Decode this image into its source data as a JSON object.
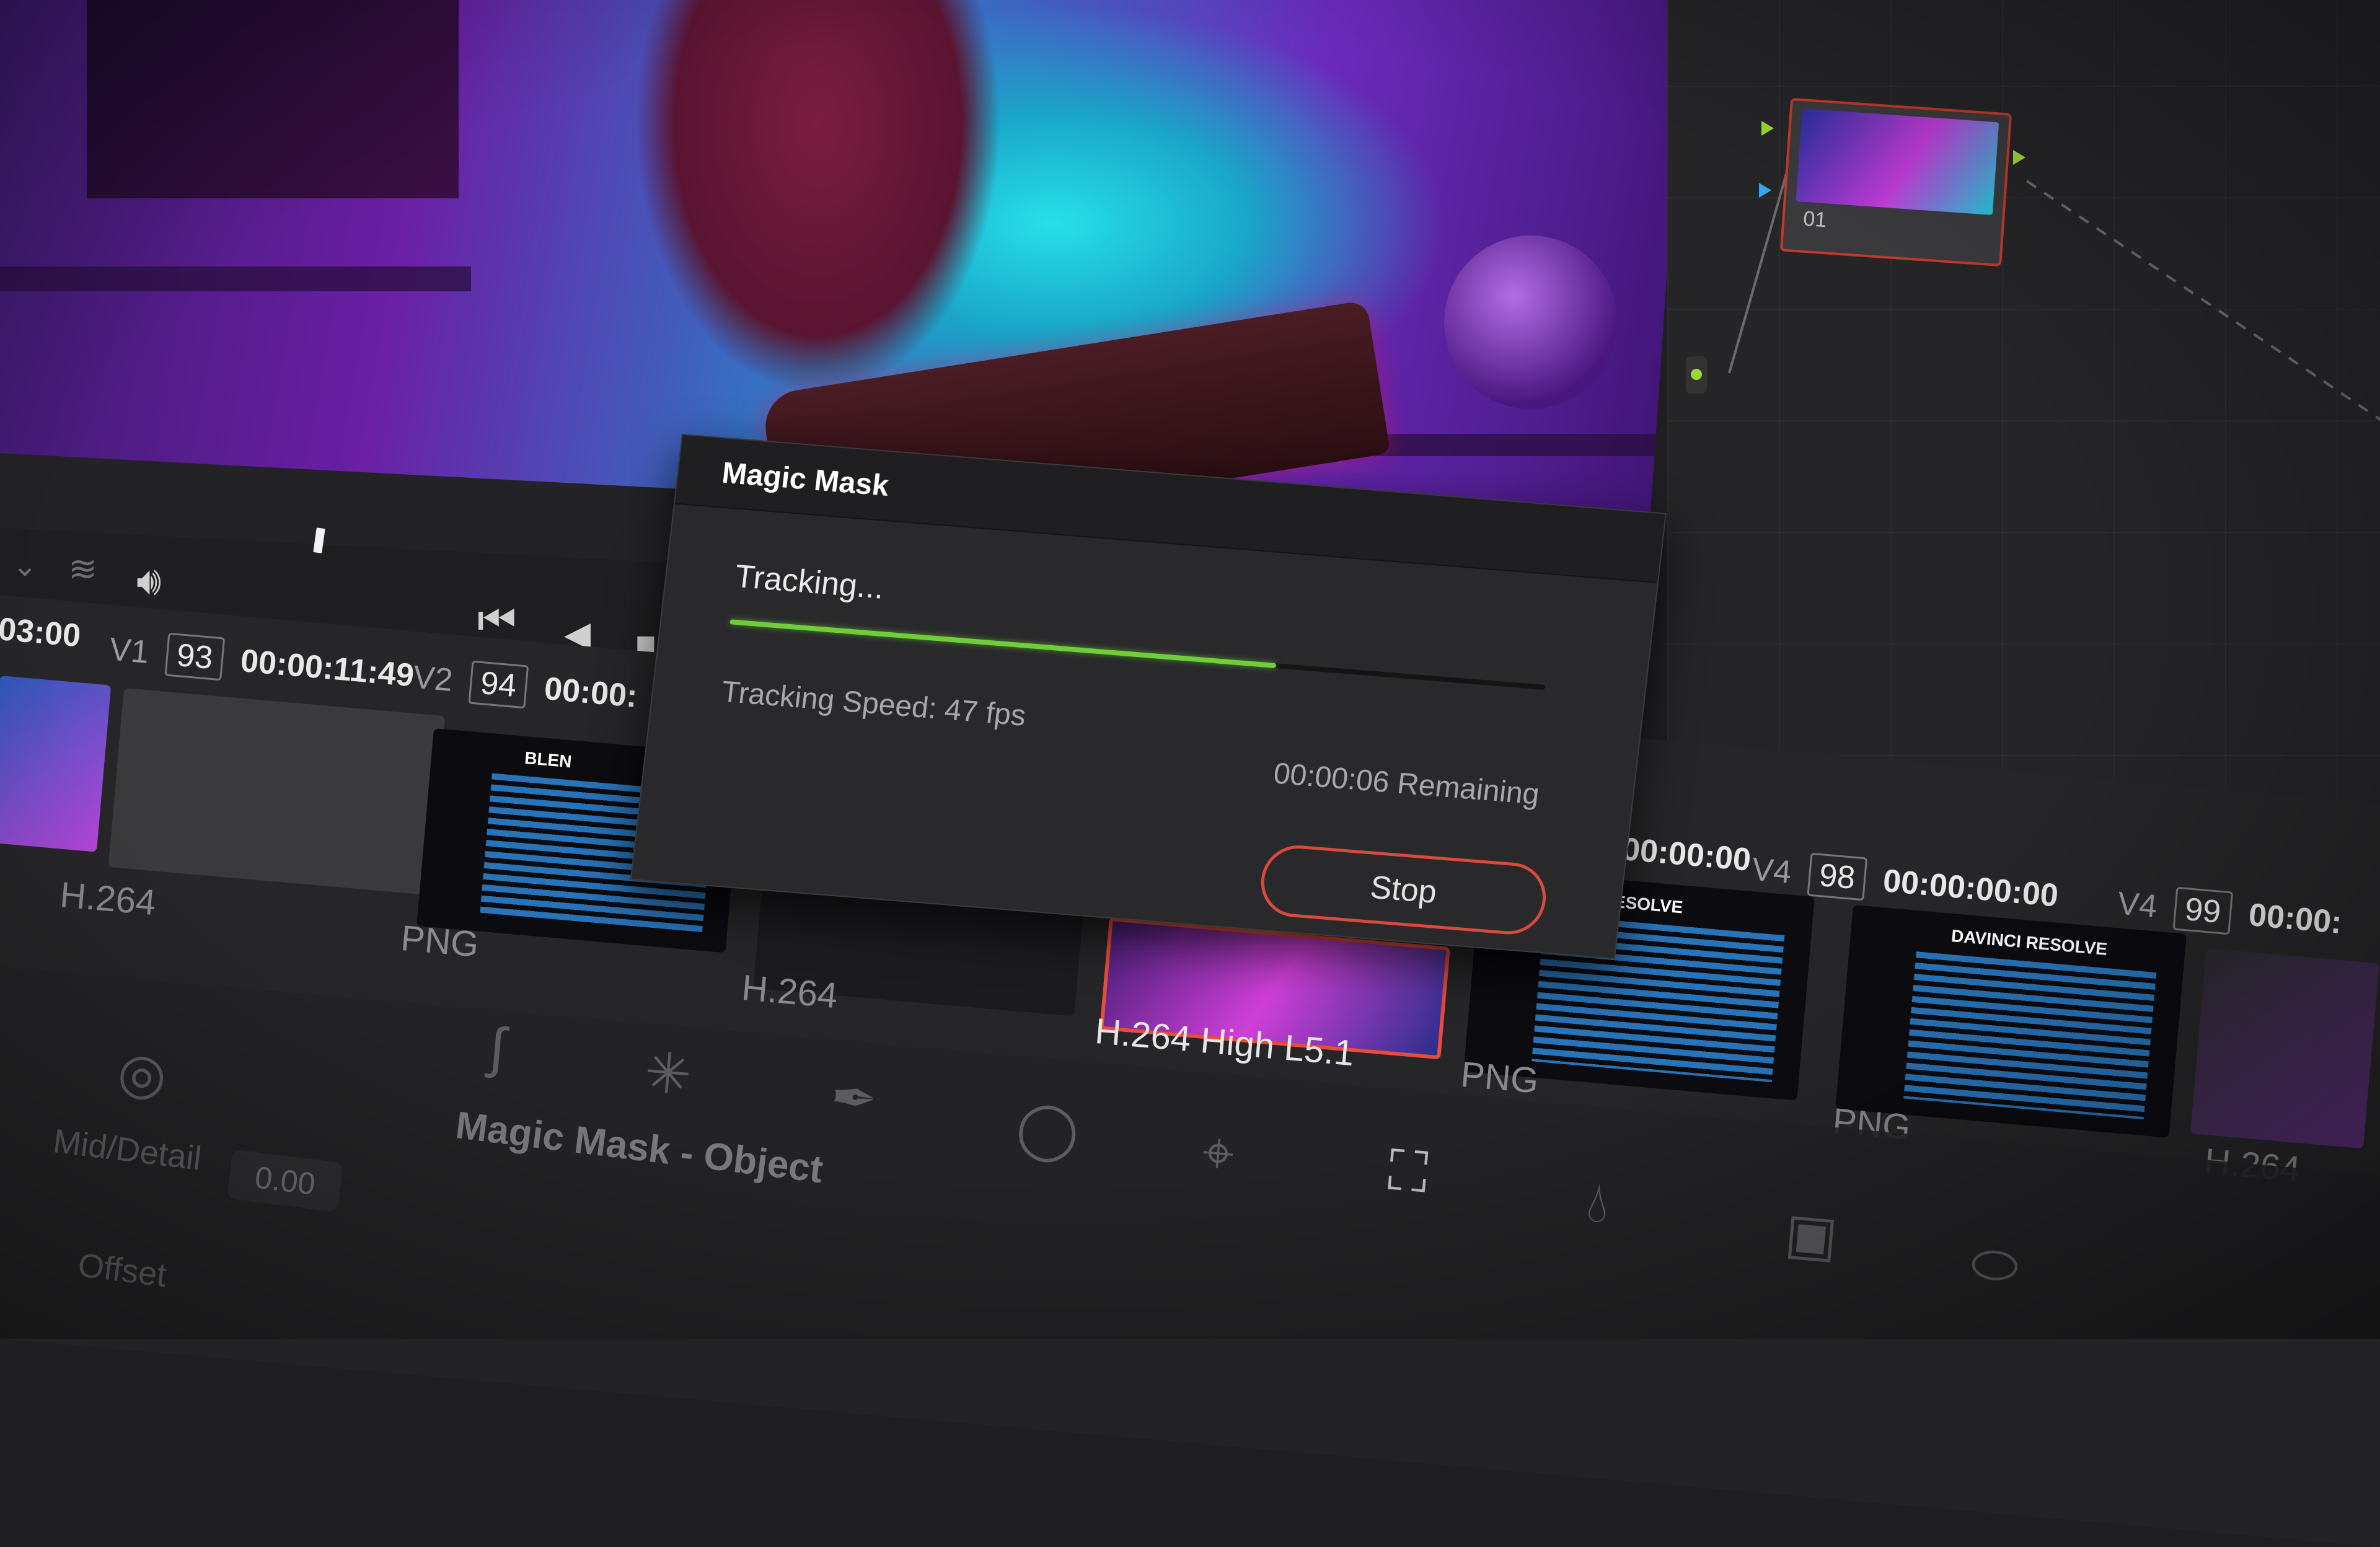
{
  "dialog": {
    "title": "Magic Mask",
    "status": "Tracking...",
    "progress_fraction": 0.67,
    "speed": "Tracking Speed: 47 fps",
    "remaining": "00:00:06 Remaining",
    "stop_label": "Stop",
    "progress_color": "#6fce3a",
    "stop_border_color": "#d84a3c"
  },
  "clips": [
    {
      "track": "V1",
      "number": "93",
      "timecode": "00:00:11:49",
      "codec": "H.264"
    },
    {
      "track": "V2",
      "number": "94",
      "timecode": "00:00:",
      "codec": "PNG"
    },
    {
      "codec": "H.264"
    },
    {
      "codec": "H.264 High L5.1",
      "selected": true
    },
    {
      "track": "",
      "number": "",
      "timecode": "00:00:00",
      "codec": "PNG",
      "thumb_title": "CI RESOLVE"
    },
    {
      "track": "V4",
      "number": "98",
      "timecode": "00:00:00:00",
      "codec": "PNG",
      "thumb_title": "DAVINCI RESOLVE"
    },
    {
      "track": "V4",
      "number": "99",
      "timecode": "00:00:",
      "codec": "H.264"
    }
  ],
  "clip_header_left": "03:00",
  "node": {
    "label": "01"
  },
  "palette": {
    "title": "Magic Mask - Object",
    "mid_detail_label": "Mid/Detail",
    "mid_detail_value": "0.00",
    "offset_label": "Offset"
  },
  "icons": {
    "chevron": "chevron-down-icon",
    "layers": "layers-icon",
    "volume": "volume-icon",
    "skip_back": "skip-to-start-icon",
    "play_reverse": "play-reverse-icon",
    "stop": "stop-icon"
  },
  "thumb_blen_title": "BLEN"
}
